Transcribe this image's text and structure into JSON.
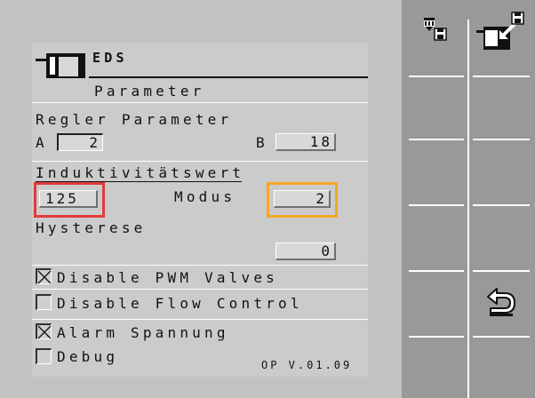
{
  "header": {
    "title": "EDS",
    "subtitle": "Parameter"
  },
  "regler": {
    "label": "Regler Parameter",
    "a_label": "A",
    "a_value": "2",
    "b_label": "B",
    "b_value": "18"
  },
  "induktivitaet": {
    "label": "Induktivitätswert",
    "value": "125",
    "modus_label": "Modus",
    "modus_value": "2"
  },
  "hysterese": {
    "label": "Hysterese",
    "value": "0"
  },
  "checkboxes": [
    {
      "label": "Disable PWM Valves",
      "checked": true
    },
    {
      "label": "Disable Flow Control",
      "checked": false
    },
    {
      "label": "Alarm Spannung",
      "checked": true
    },
    {
      "label": "Debug",
      "checked": false
    }
  ],
  "version": "OP V.01.09",
  "softkeys": [
    {
      "icon": "device-save-icon"
    },
    {
      "icon": "export-save-icon"
    },
    {
      "icon": ""
    },
    {
      "icon": ""
    },
    {
      "icon": ""
    },
    {
      "icon": "back-arrow-icon"
    },
    {
      "icon": ""
    }
  ],
  "colors": {
    "highlight_red": "#e23b3b",
    "highlight_orange": "#f5a623"
  }
}
